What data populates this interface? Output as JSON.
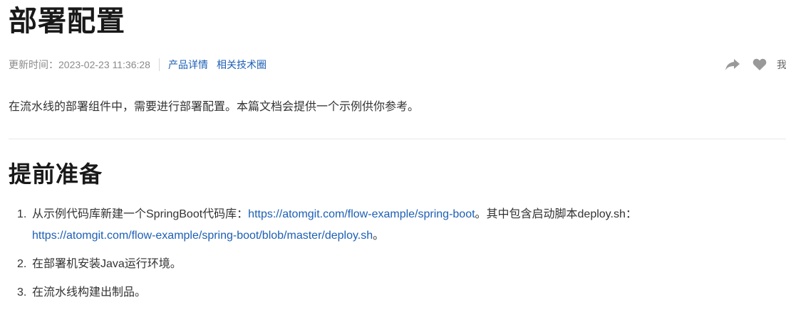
{
  "article": {
    "title": "部署配置",
    "update_label": "更新时间：",
    "update_time": "2023-02-23 11:36:28",
    "links": [
      "产品详情",
      "相关技术圈"
    ],
    "actions": {
      "share_icon": "share-icon",
      "like_icon": "heart-icon",
      "truncated_text": "我"
    },
    "intro": "在流水线的部署组件中，需要进行部署配置。本篇文档会提供一个示例供你参考。"
  },
  "section": {
    "title": "提前准备",
    "steps": [
      {
        "number": "1.",
        "text_a": "从示例代码库新建一个SpringBoot代码库：",
        "link_a": "https://atomgit.com/flow-example/spring-boot",
        "text_b": "。其中包含启动脚本deploy.sh：",
        "link_b": "https://atomgit.com/flow-example/spring-boot/blob/master/deploy.sh",
        "text_c": "。"
      },
      {
        "number": "2.",
        "text": "在部署机安装Java运行环境。"
      },
      {
        "number": "3.",
        "text": "在流水线构建出制品。"
      }
    ]
  },
  "colors": {
    "link": "#1d5fb4",
    "icon": "#999999",
    "meta": "#8a8a8a"
  }
}
